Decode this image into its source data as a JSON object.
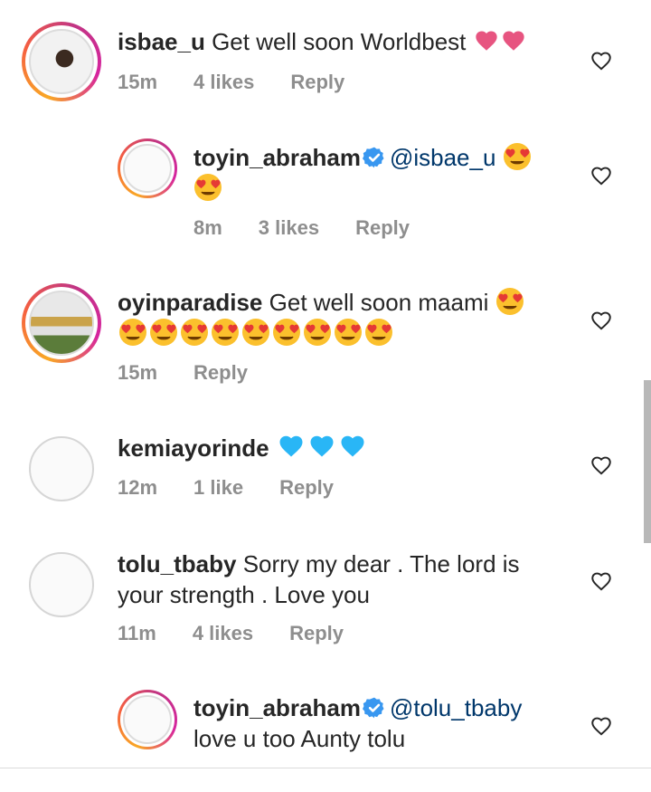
{
  "comments": [
    {
      "username": "isbae_u",
      "text": "Get well soon Worldbest",
      "time": "15m",
      "likes": "4 likes",
      "reply": "Reply",
      "emoji": "pink-heart x2"
    },
    {
      "username": "toyin_abraham",
      "mention": "@isbae_u",
      "text": "",
      "time": "8m",
      "likes": "3 likes",
      "reply": "Reply",
      "verified": true
    },
    {
      "username": "oyinparadise",
      "text": "Get well soon maami",
      "time": "15m",
      "likes": "",
      "reply": "Reply"
    },
    {
      "username": "kemiayorinde",
      "text": "",
      "time": "12m",
      "likes": "1 like",
      "reply": "Reply",
      "emoji": "blue-heart x3"
    },
    {
      "username": "tolu_tbaby",
      "text": "Sorry my dear . The lord is",
      "text2": "your strength . Love you",
      "time": "11m",
      "likes": "4 likes",
      "reply": "Reply"
    },
    {
      "username": "toyin_abraham",
      "mention": "@tolu_tbaby",
      "text": "love u too Aunty tolu",
      "verified": true
    }
  ],
  "colors": {
    "username": "#262626",
    "mention": "#00376b",
    "meta": "#8e8e8e",
    "pink_heart": "#e75480",
    "blue_heart": "#29b6f6",
    "verified": "#3897f0"
  },
  "icons": [
    "like-heart-outline-icon",
    "verified-badge-icon",
    "heart-eyes-emoji-icon",
    "pink-heart-emoji-icon",
    "blue-heart-emoji-icon"
  ]
}
